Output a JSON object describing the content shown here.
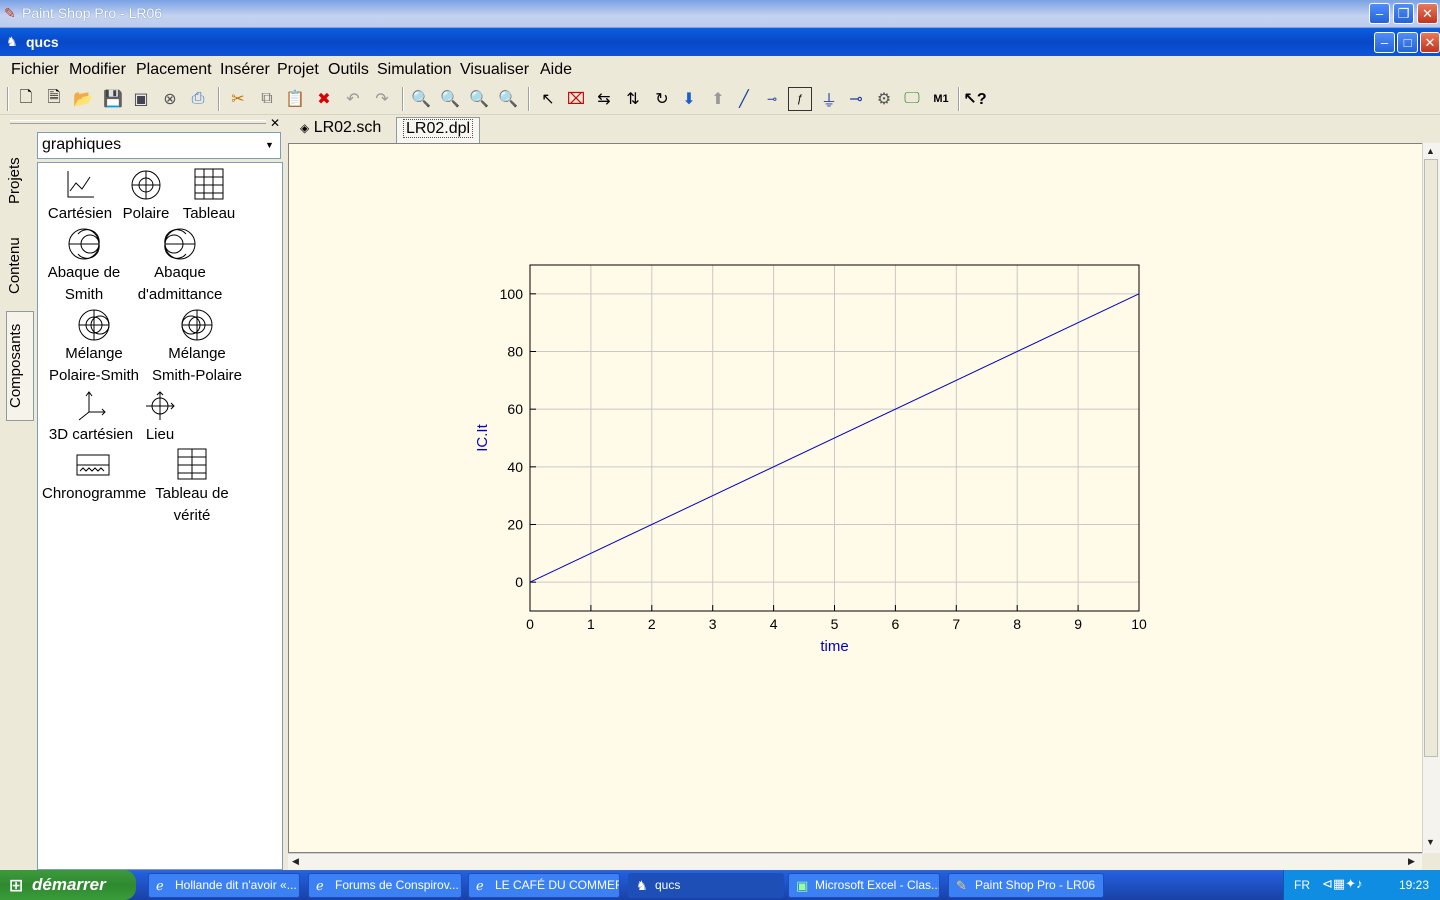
{
  "outer_window": {
    "title": "Paint Shop Pro - LR06"
  },
  "app_window": {
    "title": "qucs"
  },
  "menu": [
    "Fichier",
    "Modifier",
    "Placement",
    "Insérer",
    "Projet",
    "Outils",
    "Simulation",
    "Visualiser",
    "Aide"
  ],
  "toolbar_icons": [
    "new-file-icon",
    "new-text-icon",
    "open-icon",
    "save-icon",
    "save-all-icon",
    "close-doc-icon",
    "print-icon",
    "cut-icon",
    "copy-icon",
    "paste-icon",
    "delete-icon",
    "undo-icon",
    "redo-icon",
    "zoom-in-icon",
    "zoom-1-icon",
    "zoom-fit-icon",
    "zoom-out-icon",
    "select-icon",
    "edit-props-icon",
    "mirror-x-icon",
    "mirror-y-icon",
    "rotate-icon",
    "enter-subcircuit-icon",
    "leave-subcircuit-icon",
    "wire-icon",
    "wire-label-icon",
    "equation-icon",
    "ground-icon",
    "port-icon",
    "simulate-icon",
    "view-data-icon",
    "marker-icon",
    "whats-this-icon"
  ],
  "dock": {
    "tabs": [
      "Projets",
      "Contenu",
      "Composants"
    ],
    "category": "graphiques",
    "components": [
      {
        "label": "Cartésien",
        "icon": "cartesian-icon"
      },
      {
        "label": "Polaire",
        "icon": "polar-icon"
      },
      {
        "label": "Tableau",
        "icon": "table-icon"
      },
      {
        "label": "Abaque de Smith",
        "icon": "smith-chart-icon"
      },
      {
        "label": "Abaque d'admittance",
        "icon": "admittance-chart-icon"
      },
      {
        "label": "Mélange Polaire-Smith",
        "icon": "polar-smith-icon"
      },
      {
        "label": "Mélange Smith-Polaire",
        "icon": "smith-polar-icon"
      },
      {
        "label": "3D cartésien",
        "icon": "cartesian-3d-icon"
      },
      {
        "label": "Lieu",
        "icon": "locus-icon"
      },
      {
        "label": "Chronogramme",
        "icon": "timing-diagram-icon"
      },
      {
        "label": "Tableau de vérité",
        "icon": "truth-table-icon"
      }
    ]
  },
  "doc_tabs": [
    {
      "label": "LR02.sch",
      "active": false
    },
    {
      "label": "LR02.dpl",
      "active": true
    }
  ],
  "chart_data": {
    "type": "line",
    "xlabel": "time",
    "ylabel": "IC.It",
    "xlim": [
      0,
      10
    ],
    "ylim": [
      -10,
      110
    ],
    "xticks": [
      0,
      1,
      2,
      3,
      4,
      5,
      6,
      7,
      8,
      9,
      10
    ],
    "yticks": [
      0,
      20,
      40,
      60,
      80,
      100
    ],
    "grid": true,
    "series": [
      {
        "x": [
          0,
          10
        ],
        "y": [
          0,
          100
        ],
        "color": "#0000cc"
      }
    ],
    "axis_label_color": "#0000cc",
    "plot_background": "#fffbe8"
  },
  "taskbar": {
    "start_label": "démarrer",
    "tasks": [
      {
        "label": "Hollande dit n'avoir «...",
        "icon": "ie-icon",
        "active": false
      },
      {
        "label": "Forums de Conspirov...",
        "icon": "ie-icon",
        "active": false
      },
      {
        "label": "LE CAFÉ DU COMMER...",
        "icon": "ie-icon",
        "active": false
      },
      {
        "label": "qucs",
        "icon": "qucs-icon",
        "active": true
      },
      {
        "label": "Microsoft Excel - Clas...",
        "icon": "excel-icon",
        "active": false
      },
      {
        "label": "Paint Shop Pro - LR06",
        "icon": "psp-icon",
        "active": false
      }
    ],
    "lang": "FR",
    "clock": "19:23"
  }
}
